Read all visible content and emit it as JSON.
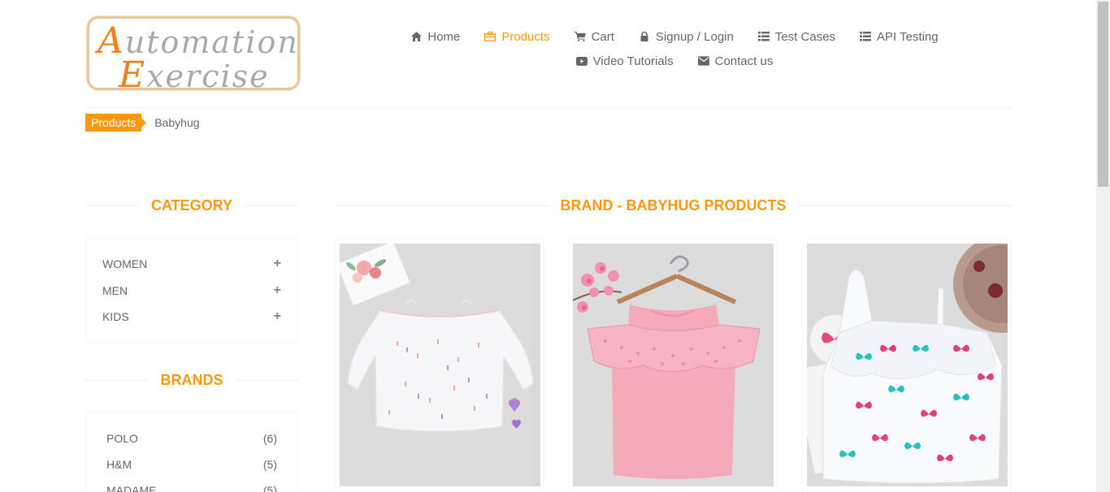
{
  "logo": {
    "line1_cap": "A",
    "line1_rest": "utomation",
    "line2_cap": "E",
    "line2_rest": "xercise"
  },
  "nav": {
    "row1": [
      {
        "label": "Home",
        "icon": "home-icon",
        "active": false
      },
      {
        "label": "Products",
        "icon": "products-icon",
        "active": true
      },
      {
        "label": "Cart",
        "icon": "cart-icon",
        "active": false
      },
      {
        "label": "Signup / Login",
        "icon": "lock-icon",
        "active": false
      },
      {
        "label": "Test Cases",
        "icon": "list-icon",
        "active": false
      },
      {
        "label": "API Testing",
        "icon": "list-icon",
        "active": false
      }
    ],
    "row2": [
      {
        "label": "Video Tutorials",
        "icon": "youtube-icon",
        "active": false
      },
      {
        "label": "Contact us",
        "icon": "envelope-icon",
        "active": false
      }
    ]
  },
  "breadcrumb": {
    "active": "Products",
    "current": "Babyhug"
  },
  "sidebar": {
    "category_title": "CATEGORY",
    "categories": [
      {
        "label": "Women",
        "toggle": "+"
      },
      {
        "label": "Men",
        "toggle": "+"
      },
      {
        "label": "Kids",
        "toggle": "+"
      }
    ],
    "brands_title": "BRANDS",
    "brands": [
      {
        "label": "Polo",
        "count": "(6)"
      },
      {
        "label": "H&M",
        "count": "(5)"
      },
      {
        "label": "Madame",
        "count": "(5)"
      }
    ]
  },
  "main": {
    "title": "BRAND - BABYHUG PRODUCTS"
  },
  "colors": {
    "accent": "#fe980f",
    "text": "#696763"
  }
}
